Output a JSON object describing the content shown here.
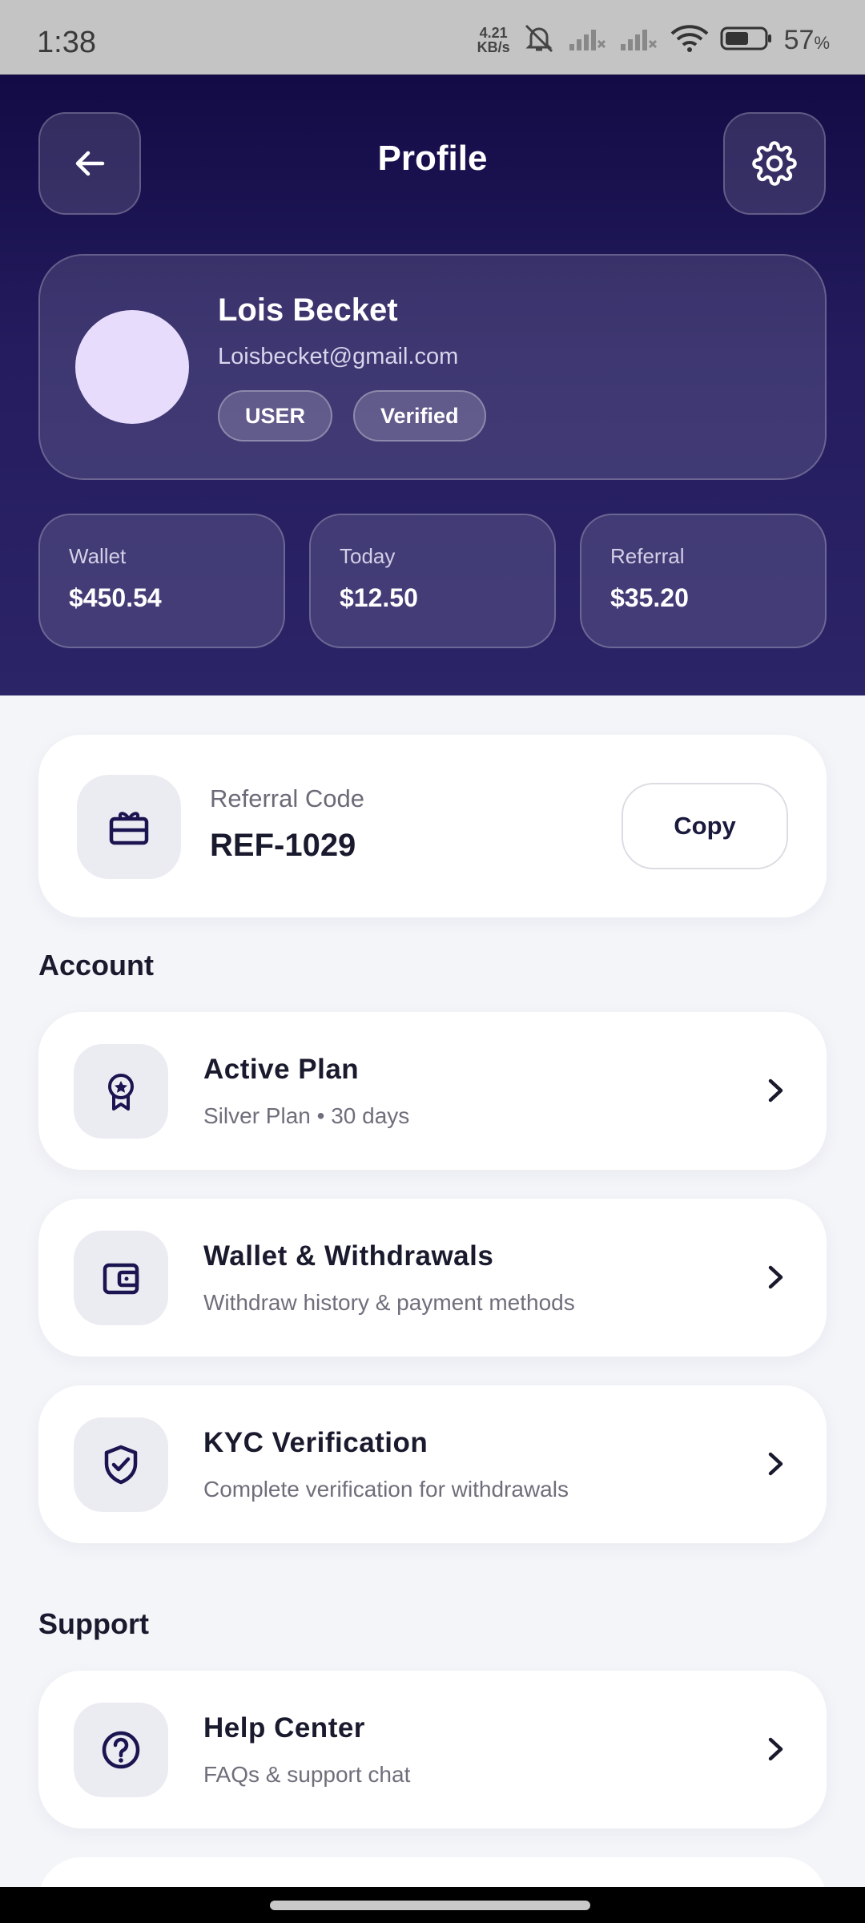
{
  "status": {
    "time": "1:38",
    "speed_top": "4.21",
    "speed_bottom": "KB/s",
    "battery": "57",
    "battery_unit": "%"
  },
  "header": {
    "title": "Profile"
  },
  "profile": {
    "name": "Lois Becket",
    "email": "Loisbecket@gmail.com",
    "badges": [
      "USER",
      "Verified"
    ]
  },
  "stats": [
    {
      "label": "Wallet",
      "value": "$450.54"
    },
    {
      "label": "Today",
      "value": "$12.50"
    },
    {
      "label": "Referral",
      "value": "$35.20"
    }
  ],
  "referral": {
    "label": "Referral Code",
    "code": "REF-1029",
    "copy_label": "Copy"
  },
  "account": {
    "heading": "Account",
    "items": [
      {
        "title": "Active Plan",
        "subtitle": "Silver Plan  •  30 days",
        "icon": "award-icon"
      },
      {
        "title": "Wallet & Withdrawals",
        "subtitle": "Withdraw history & payment methods",
        "icon": "wallet-icon"
      },
      {
        "title": "KYC Verification",
        "subtitle": "Complete verification for withdrawals",
        "icon": "shield-check-icon"
      }
    ]
  },
  "support": {
    "heading": "Support",
    "items": [
      {
        "title": "Help Center",
        "subtitle": "FAQs & support chat",
        "icon": "help-circle-icon"
      }
    ]
  },
  "colors": {
    "header_top": "#120b45",
    "header_bottom": "#2b2466",
    "avatar": "#e8dcfd",
    "icon_stroke": "#1a1450"
  }
}
